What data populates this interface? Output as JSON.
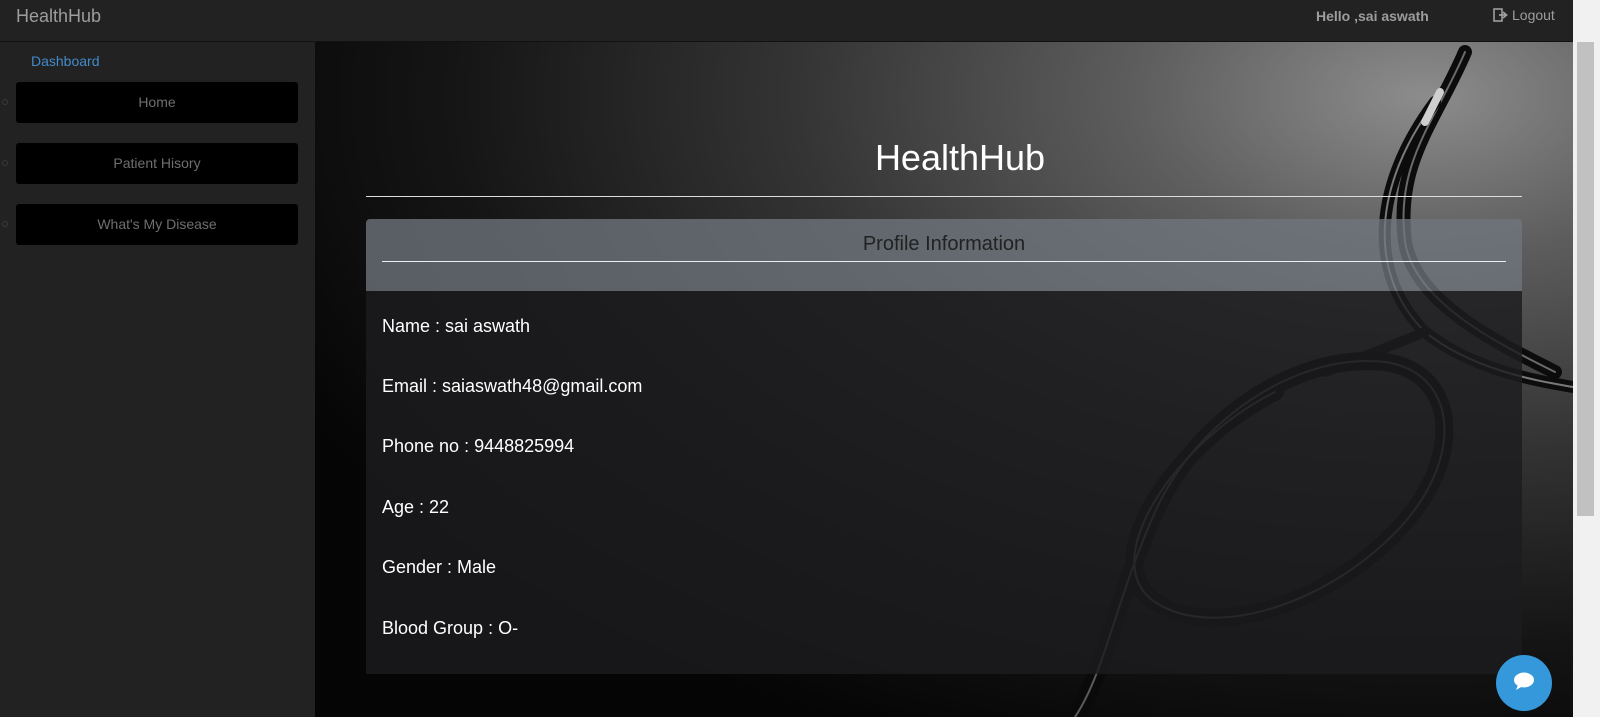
{
  "navbar": {
    "brand": "HealthHub",
    "greeting": "Hello ,sai aswath",
    "logout_label": "Logout",
    "logout_icon": "logout-icon"
  },
  "sidebar": {
    "section_label": "Dashboard",
    "items": [
      {
        "label": "Home"
      },
      {
        "label": "Patient Hisory"
      },
      {
        "label": "What's My Disease"
      }
    ]
  },
  "main": {
    "title": "HealthHub",
    "card": {
      "title": "Profile Information",
      "fields": [
        {
          "text": "Name : sai aswath"
        },
        {
          "text": "Email : saiaswath48@gmail.com"
        },
        {
          "text": "Phone no : 9448825994"
        },
        {
          "text": "Age : 22"
        },
        {
          "text": "Gender : Male"
        },
        {
          "text": "Blood Group : O-"
        }
      ]
    }
  },
  "chat": {
    "icon": "chat-bubble-icon"
  },
  "colors": {
    "accent_link": "#428bca",
    "chat_button": "#3498db",
    "navbar_bg": "#222222",
    "sidebar_button_bg": "#000000"
  }
}
